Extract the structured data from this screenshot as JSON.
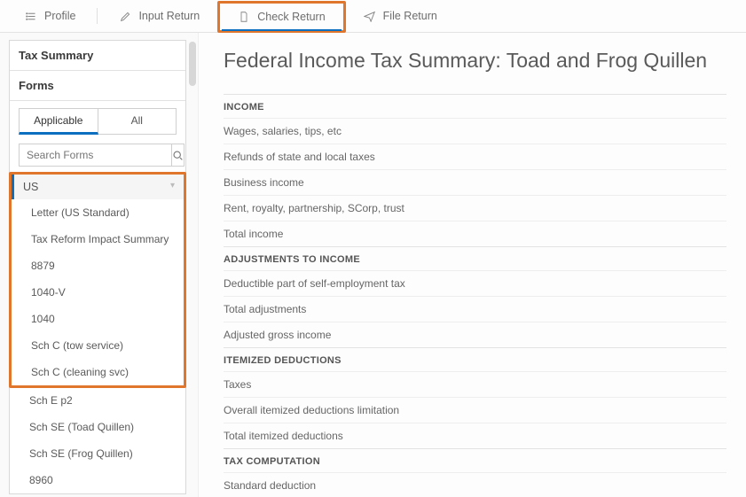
{
  "topnav": {
    "profile": "Profile",
    "input_return": "Input Return",
    "check_return": "Check Return",
    "file_return": "File Return"
  },
  "sidebar": {
    "tax_summary": "Tax Summary",
    "forms": "Forms",
    "tab_applicable": "Applicable",
    "tab_all": "All",
    "search_placeholder": "Search Forms",
    "group": "US",
    "items": [
      "Letter (US Standard)",
      "Tax Reform Impact Summary",
      "8879",
      "1040-V",
      "1040",
      "Sch C (tow service)",
      "Sch C (cleaning svc)",
      "Sch E p2",
      "Sch SE (Toad Quillen)",
      "Sch SE (Frog Quillen)",
      "8960"
    ]
  },
  "main": {
    "title": "Federal Income Tax Summary: Toad and Frog Quillen",
    "sections": [
      {
        "label": "INCOME",
        "rows": [
          "Wages, salaries, tips, etc",
          "Refunds of state and local taxes",
          "Business income",
          "Rent, royalty, partnership, SCorp, trust",
          "Total income"
        ]
      },
      {
        "label": "ADJUSTMENTS TO INCOME",
        "rows": [
          "Deductible part of self-employment tax",
          "Total adjustments",
          "Adjusted gross income"
        ]
      },
      {
        "label": "ITEMIZED DEDUCTIONS",
        "rows": [
          "Taxes",
          "Overall itemized deductions limitation",
          "Total itemized deductions"
        ]
      },
      {
        "label": "TAX COMPUTATION",
        "rows": [
          "Standard deduction"
        ]
      }
    ]
  }
}
